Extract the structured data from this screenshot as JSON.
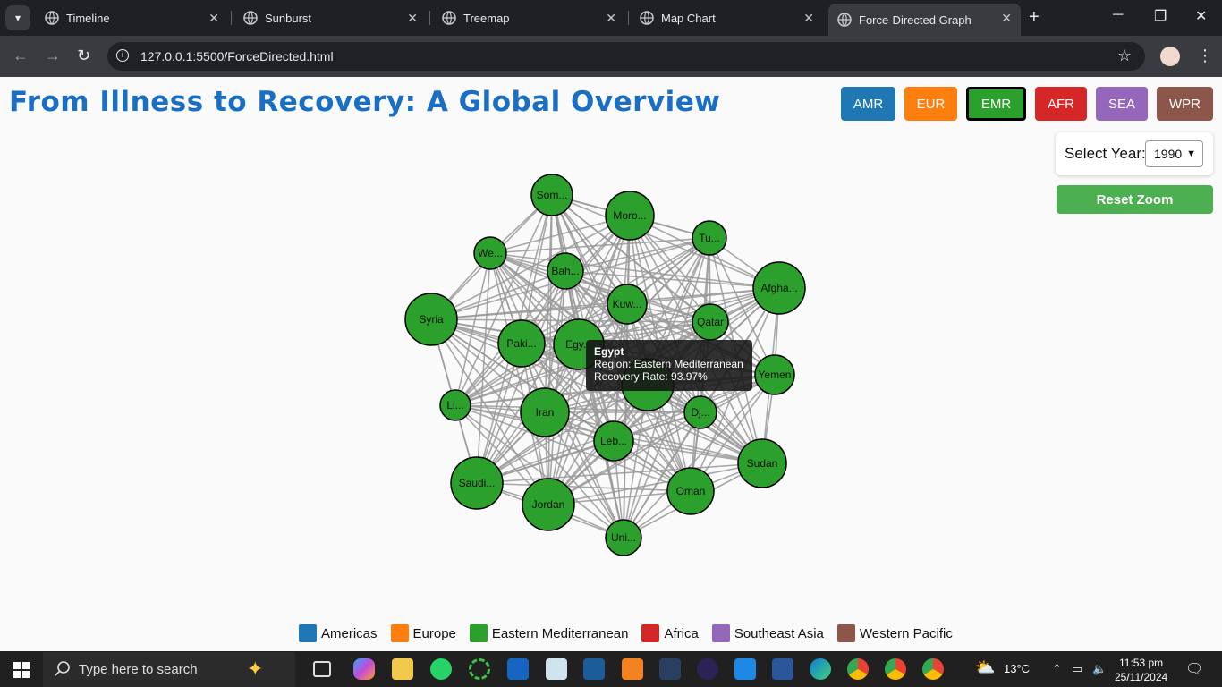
{
  "browser": {
    "tabs": [
      {
        "label": "Timeline"
      },
      {
        "label": "Sunburst"
      },
      {
        "label": "Treemap"
      },
      {
        "label": "Map Chart"
      },
      {
        "label": "Force-Directed Graph"
      }
    ],
    "url": "127.0.0.1:5500/ForceDirected.html"
  },
  "page": {
    "title": "From Illness to Recovery: A Global Overview",
    "region_buttons": [
      {
        "label": "AMR",
        "color": "#1f77b4"
      },
      {
        "label": "EUR",
        "color": "#ff7f0e"
      },
      {
        "label": "EMR",
        "color": "#2ca02c",
        "selected": true
      },
      {
        "label": "AFR",
        "color": "#d62728"
      },
      {
        "label": "SEA",
        "color": "#9467bd"
      },
      {
        "label": "WPR",
        "color": "#8c564b"
      }
    ],
    "year_label": "Select Year:",
    "year_value": "1990",
    "reset_label": "Reset Zoom"
  },
  "graph": {
    "node_color": "#2ca02c",
    "link_color": "#999999",
    "nodes": [
      {
        "label": "Som..."
      },
      {
        "label": "Moro..."
      },
      {
        "label": "Tu..."
      },
      {
        "label": "We..."
      },
      {
        "label": "Bah..."
      },
      {
        "label": "Afgha..."
      },
      {
        "label": "Kuw..."
      },
      {
        "label": "Syria"
      },
      {
        "label": "Qatar"
      },
      {
        "label": "Paki..."
      },
      {
        "label": "Egy..."
      },
      {
        "label": "Yemen"
      },
      {
        "label": ""
      },
      {
        "label": "Li..."
      },
      {
        "label": "Iran"
      },
      {
        "label": "Dj..."
      },
      {
        "label": "Leb..."
      },
      {
        "label": "Sudan"
      },
      {
        "label": "Saudi..."
      },
      {
        "label": "Oman"
      },
      {
        "label": "Jordan"
      },
      {
        "label": "Uni..."
      }
    ]
  },
  "tooltip": {
    "name": "Egypt",
    "region": "Region: Eastern Mediterranean",
    "rate": "Recovery Rate: 93.97%"
  },
  "legend": [
    {
      "label": "Americas",
      "color": "#1f77b4"
    },
    {
      "label": "Europe",
      "color": "#ff7f0e"
    },
    {
      "label": "Eastern Mediterranean",
      "color": "#2ca02c"
    },
    {
      "label": "Africa",
      "color": "#d62728"
    },
    {
      "label": "Southeast Asia",
      "color": "#9467bd"
    },
    {
      "label": "Western Pacific",
      "color": "#8c564b"
    }
  ],
  "taskbar": {
    "search_placeholder": "Type here to search",
    "temperature": "13°C",
    "time": "11:53 pm",
    "date": "25/11/2024"
  }
}
